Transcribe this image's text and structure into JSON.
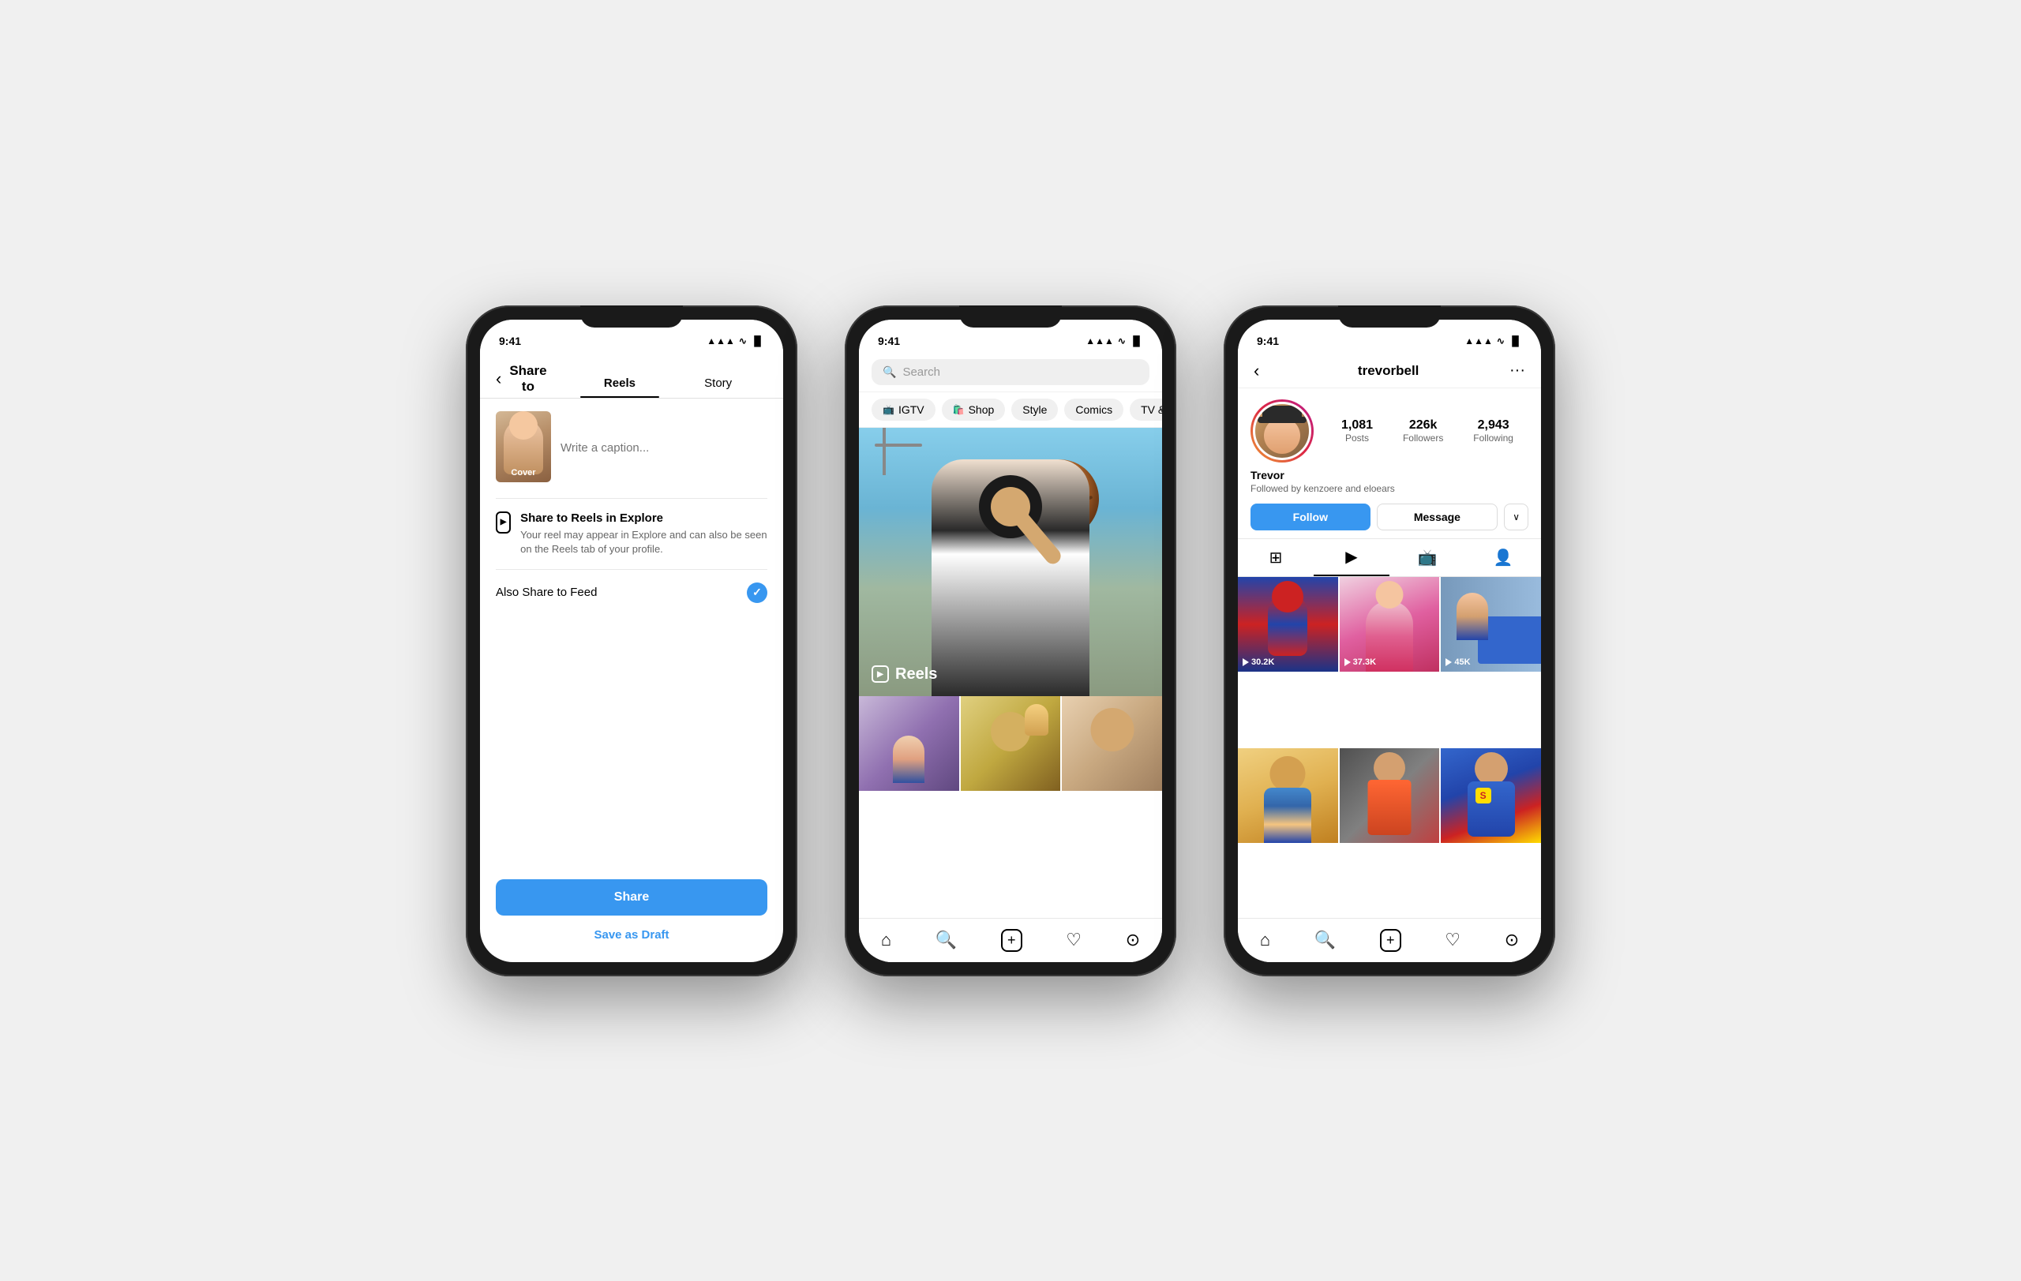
{
  "background": "#f0f0f0",
  "phones": [
    {
      "id": "phone1",
      "statusBar": {
        "time": "9:41",
        "icons": "▲▲▲"
      },
      "header": {
        "backLabel": "‹",
        "title": "Share to"
      },
      "tabs": [
        {
          "label": "Reels",
          "active": true
        },
        {
          "label": "Story",
          "active": false
        }
      ],
      "caption": {
        "placeholder": "Write a caption..."
      },
      "coverLabel": "Cover",
      "shareExplore": {
        "title": "Share to Reels in Explore",
        "description": "Your reel may appear in Explore and can also be seen on the Reels tab of your profile."
      },
      "alsoShare": {
        "label": "Also Share to Feed"
      },
      "shareBtn": "Share",
      "draftBtn": "Save as Draft"
    },
    {
      "id": "phone2",
      "statusBar": {
        "time": "9:41",
        "icons": "▲▲▲"
      },
      "searchPlaceholder": "Search",
      "categories": [
        "IGTV",
        "Shop",
        "Style",
        "Comics",
        "TV & Movie"
      ],
      "reelsLabel": "Reels"
    },
    {
      "id": "phone3",
      "statusBar": {
        "time": "9:41",
        "icons": "▲▲▲"
      },
      "username": "trevorbell",
      "stats": [
        {
          "num": "1,081",
          "label": "Posts"
        },
        {
          "num": "226k",
          "label": "Followers"
        },
        {
          "num": "2,943",
          "label": "Following"
        }
      ],
      "name": "Trevor",
      "followedBy": "Followed by kenzoere and eloears",
      "followBtn": "Follow",
      "messageBtn": "Message",
      "gridItems": [
        {
          "views": "30.2K"
        },
        {
          "views": "37.3K"
        },
        {
          "views": "45K"
        },
        {},
        {},
        {}
      ]
    }
  ]
}
